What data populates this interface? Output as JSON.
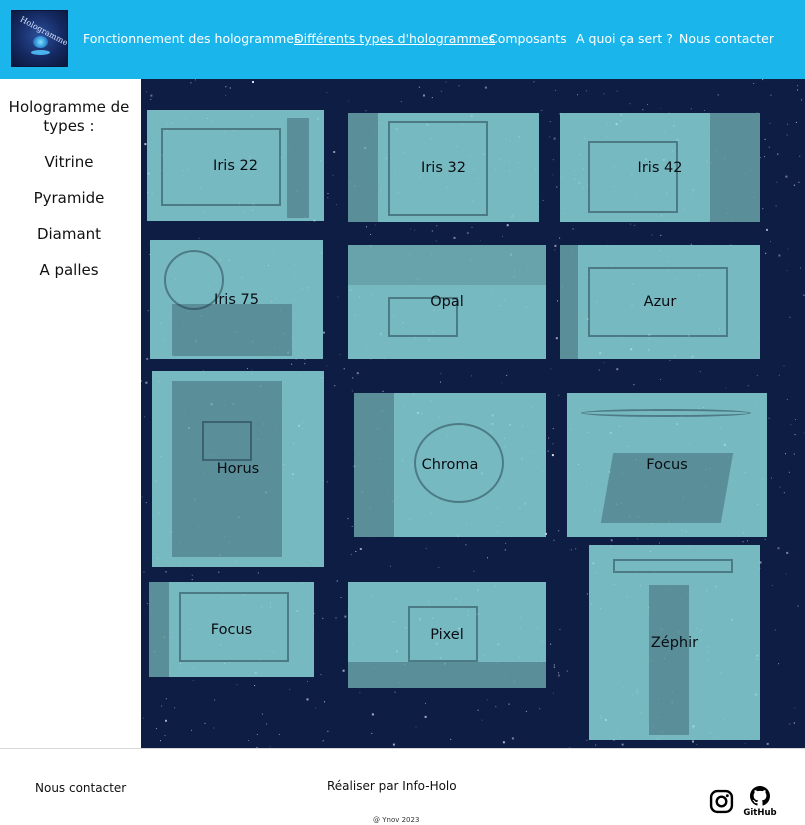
{
  "header": {
    "logo_text": "Hologramme",
    "nav": [
      {
        "label": "Fonctionnement des hologrammes"
      },
      {
        "label": "Différents types d'hologrammes"
      },
      {
        "label": "Composants"
      },
      {
        "label": "A quoi ça sert ?"
      },
      {
        "label": "Nous contacter"
      }
    ],
    "active_nav": "Différents types d'hologrammes"
  },
  "sidebar": {
    "title": "Hologramme de types :",
    "items": [
      {
        "label": "Vitrine"
      },
      {
        "label": "Pyramide"
      },
      {
        "label": "Diamant"
      },
      {
        "label": "A palles"
      }
    ]
  },
  "gallery": {
    "cards": [
      {
        "label": "Iris 22"
      },
      {
        "label": "Iris 32"
      },
      {
        "label": "Iris 42"
      },
      {
        "label": "Iris 75"
      },
      {
        "label": "Opal"
      },
      {
        "label": "Azur"
      },
      {
        "label": "Horus"
      },
      {
        "label": "Chroma"
      },
      {
        "label": "Focus"
      },
      {
        "label": "Focus"
      },
      {
        "label": "Pixel"
      },
      {
        "label": "Zéphir"
      }
    ]
  },
  "footer": {
    "contact": "Nous contacter",
    "credit": "Réaliser par Info-Holo",
    "copyright": "@ Ynov 2023",
    "github_label": "GitHub",
    "icons": [
      "instagram-icon",
      "github-icon"
    ]
  },
  "colors": {
    "header_bg": "#1ab5ea",
    "main_bg": "#0a1736",
    "card_tint": "#8fdcdc"
  }
}
